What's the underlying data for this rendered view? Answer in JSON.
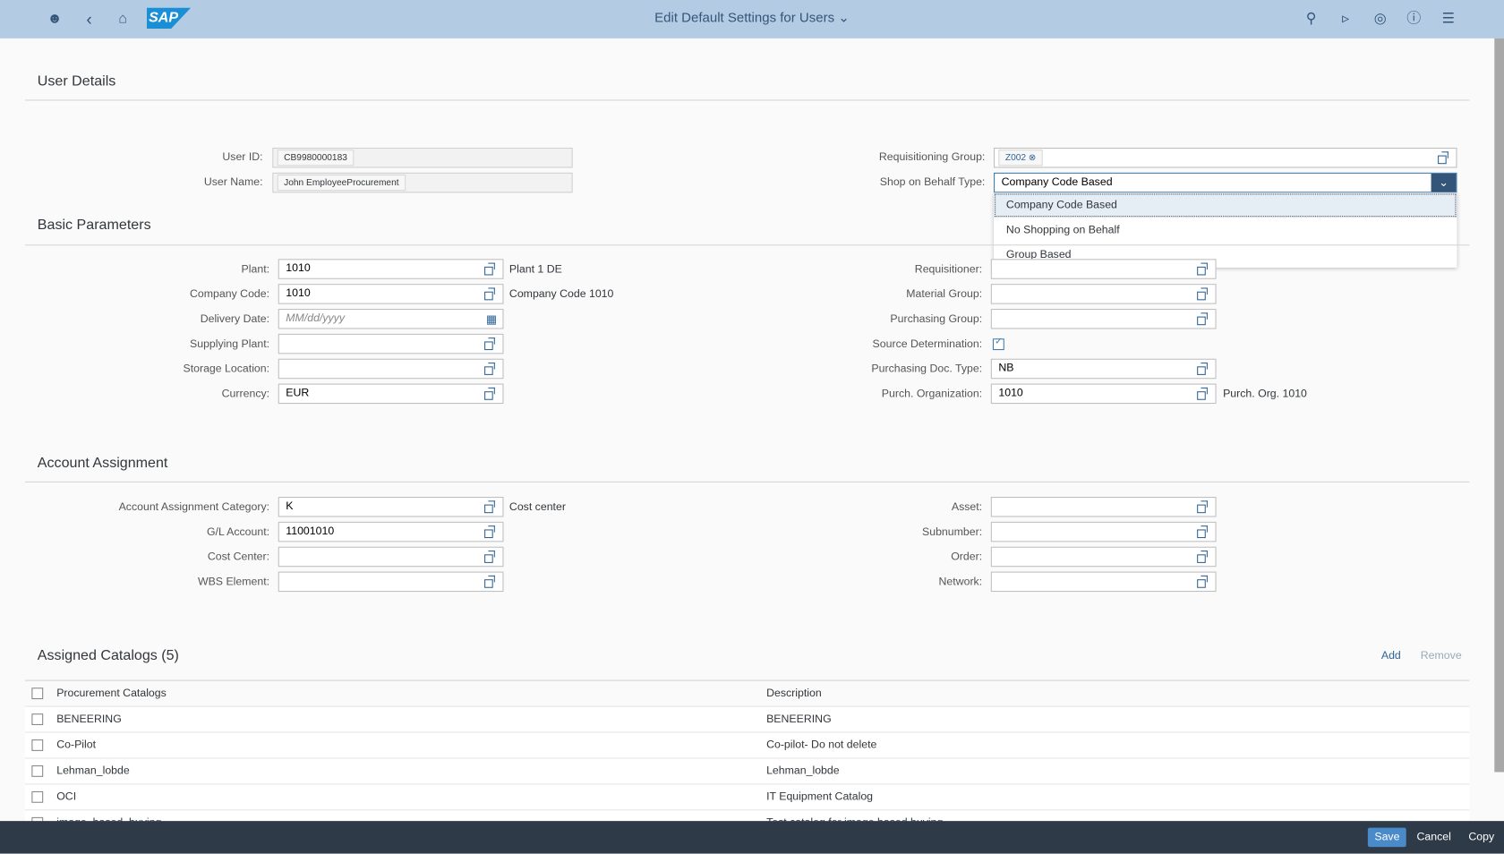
{
  "header": {
    "title": "Edit Default Settings for Users",
    "logo": "SAP",
    "icons": [
      "user-icon",
      "back-icon",
      "home-icon",
      "search-icon",
      "megaphone-icon",
      "copilot-icon",
      "help-icon",
      "menu-icon"
    ]
  },
  "user_details": {
    "title": "User Details",
    "user_id_label": "User ID:",
    "user_id": "CB9980000183",
    "user_name_label": "User Name:",
    "user_name": "John EmployeeProcurement",
    "req_group_label": "Requisitioning Group:",
    "req_group_token": "Z002",
    "sob_label": "Shop on Behalf Type:",
    "sob_value": "Company Code Based",
    "sob_options": [
      "Company Code Based",
      "No Shopping on Behalf",
      "Group Based"
    ]
  },
  "basic": {
    "title": "Basic Parameters",
    "left": [
      {
        "label": "Plant:",
        "value": "1010",
        "desc": "Plant 1 DE"
      },
      {
        "label": "Company Code:",
        "value": "1010",
        "desc": "Company Code 1010"
      },
      {
        "label": "Delivery Date:",
        "value": "",
        "placeholder": "MM/dd/yyyy",
        "desc": ""
      },
      {
        "label": "Supplying Plant:",
        "value": "",
        "desc": ""
      },
      {
        "label": "Storage Location:",
        "value": "",
        "desc": ""
      },
      {
        "label": "Currency:",
        "value": "EUR",
        "desc": ""
      }
    ],
    "right": [
      {
        "label": "Requisitioner:",
        "value": "",
        "desc": ""
      },
      {
        "label": "Material Group:",
        "value": "",
        "desc": ""
      },
      {
        "label": "Purchasing Group:",
        "value": "",
        "desc": ""
      },
      {
        "label": "Source Determination:",
        "checked": true
      },
      {
        "label": "Purchasing Doc. Type:",
        "value": "NB",
        "desc": ""
      },
      {
        "label": "Purch. Organization:",
        "value": "1010",
        "desc": "Purch. Org. 1010"
      }
    ]
  },
  "account": {
    "title": "Account Assignment",
    "left": [
      {
        "label": "Account Assignment Category:",
        "value": "K",
        "desc": "Cost center"
      },
      {
        "label": "G/L Account:",
        "value": "11001010",
        "desc": ""
      },
      {
        "label": "Cost Center:",
        "value": "",
        "desc": ""
      },
      {
        "label": "WBS Element:",
        "value": "",
        "desc": ""
      }
    ],
    "right": [
      {
        "label": "Asset:",
        "value": ""
      },
      {
        "label": "Subnumber:",
        "value": ""
      },
      {
        "label": "Order:",
        "value": ""
      },
      {
        "label": "Network:",
        "value": ""
      }
    ]
  },
  "catalogs": {
    "title": "Assigned Catalogs (5)",
    "add": "Add",
    "remove": "Remove",
    "columns": [
      "Procurement Catalogs",
      "Description"
    ],
    "rows": [
      [
        "BENEERING",
        "BENEERING"
      ],
      [
        "Co-Pilot",
        "Co-pilot- Do not delete"
      ],
      [
        "Lehman_lobde",
        "Lehman_lobde"
      ],
      [
        "OCI",
        "IT Equipment Catalog"
      ],
      [
        "image_based_buying",
        "Test catalog for image based buying"
      ]
    ]
  },
  "footer": {
    "save": "Save",
    "cancel": "Cancel",
    "copy": "Copy"
  },
  "colors": {
    "header": "#b3cbe3",
    "footer": "#2e3a48",
    "accent": "#427cac",
    "save": "#4a8ac9"
  }
}
